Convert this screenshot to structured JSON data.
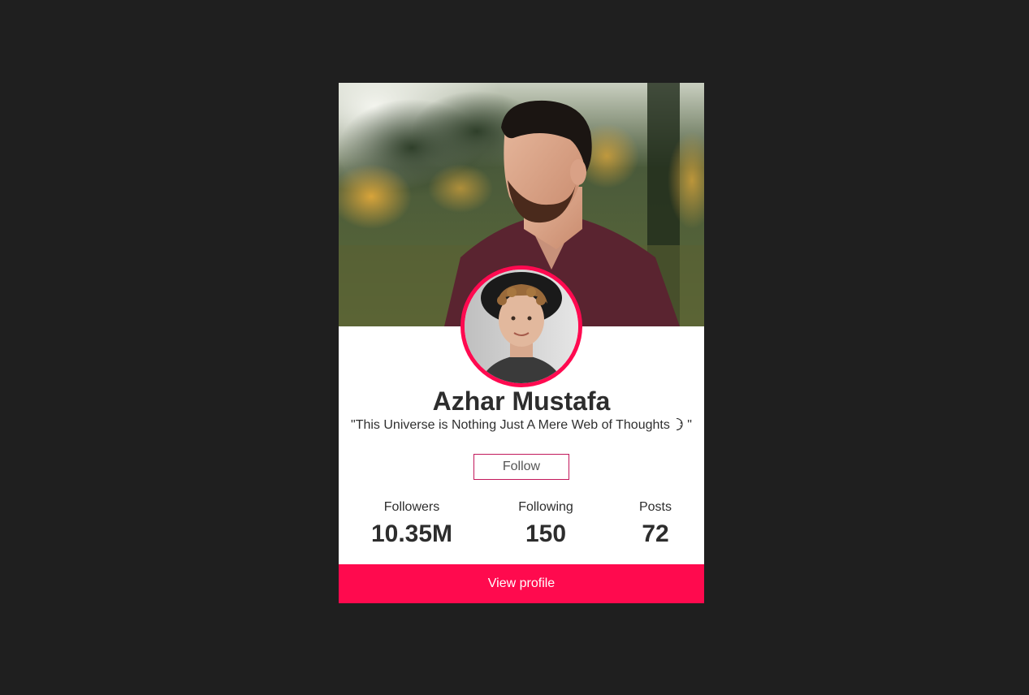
{
  "profile": {
    "name": "Azhar Mustafa",
    "bio_prefix": "\"This Universe is Nothing Just A Mere Web of Thoughts ",
    "bio_suffix": "\"",
    "bio_emoji_icon": "crescent-moon-icon"
  },
  "actions": {
    "follow_label": "Follow",
    "view_profile_label": "View profile"
  },
  "stats": [
    {
      "label": "Followers",
      "value": "10.35M"
    },
    {
      "label": "Following",
      "value": "150"
    },
    {
      "label": "Posts",
      "value": "72"
    }
  ],
  "colors": {
    "background": "#1f1f1f",
    "card": "#ffffff",
    "accent": "#ff0a4e",
    "follow_border": "#c2185b",
    "text": "#2d2d2d"
  }
}
